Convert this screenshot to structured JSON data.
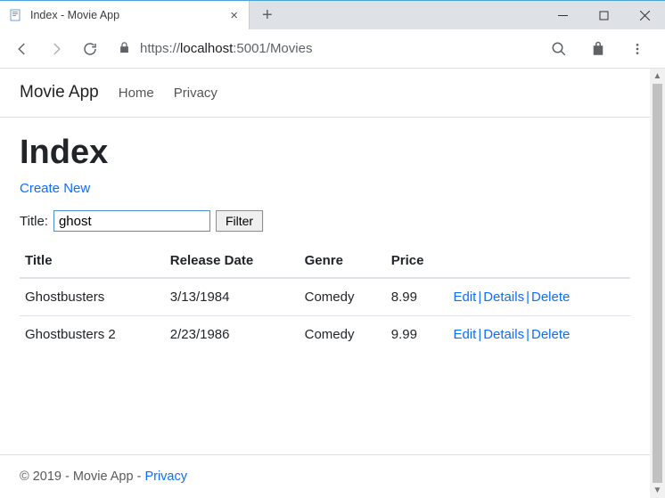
{
  "window": {
    "tab_title": "Index - Movie App",
    "url_proto": "https://",
    "url_host": "localhost",
    "url_port_path": ":5001/Movies"
  },
  "nav": {
    "brand": "Movie App",
    "home": "Home",
    "privacy": "Privacy"
  },
  "page": {
    "heading": "Index",
    "create_new": "Create New",
    "title_label": "Title:",
    "search_value": "ghost",
    "filter_button": "Filter"
  },
  "table": {
    "headers": {
      "title": "Title",
      "release_date": "Release Date",
      "genre": "Genre",
      "price": "Price"
    },
    "rows": [
      {
        "title": "Ghostbusters",
        "release_date": "3/13/1984",
        "genre": "Comedy",
        "price": "8.99"
      },
      {
        "title": "Ghostbusters 2",
        "release_date": "2/23/1986",
        "genre": "Comedy",
        "price": "9.99"
      }
    ],
    "actions": {
      "edit": "Edit",
      "details": "Details",
      "delete": "Delete"
    }
  },
  "footer": {
    "copyright": "© 2019 - Movie App - ",
    "privacy": "Privacy"
  }
}
